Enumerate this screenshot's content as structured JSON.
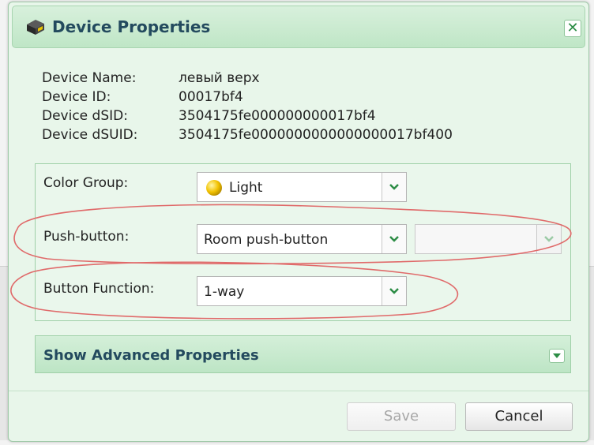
{
  "dialog": {
    "title": "Device Properties",
    "close_label": "✕"
  },
  "info": {
    "rows": [
      {
        "label": "Device Name:",
        "value": "левый верх"
      },
      {
        "label": "Device ID:",
        "value": "00017bf4"
      },
      {
        "label": "Device dSID:",
        "value": "3504175fe000000000017bf4"
      },
      {
        "label": "Device dSUID:",
        "value": "3504175fe0000000000000000017bf400"
      }
    ]
  },
  "form": {
    "color_group": {
      "label": "Color Group:",
      "value": "Light",
      "swatch_color": "#f2c200"
    },
    "push_button": {
      "label": "Push-button:",
      "value": "Room push-button",
      "secondary_value": ""
    },
    "button_function": {
      "label": "Button Function:",
      "value": "1-way"
    }
  },
  "advanced": {
    "label": "Show Advanced Properties"
  },
  "buttons": {
    "save": "Save",
    "cancel": "Cancel"
  },
  "colors": {
    "accent": "#2c8c45",
    "title": "#234a5e",
    "annotation": "#e06a6a"
  }
}
